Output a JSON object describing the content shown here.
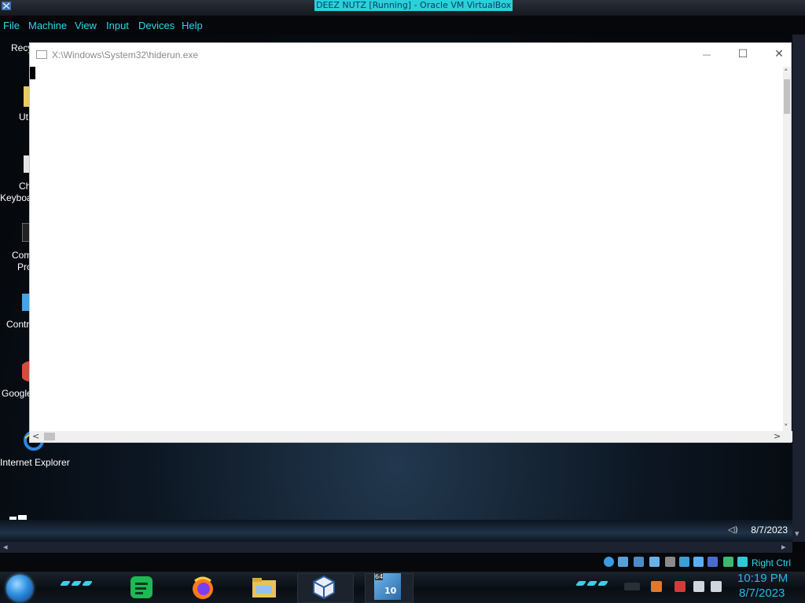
{
  "host": {
    "window_title": "DEEZ NUTZ [Running] - Oracle VM VirtualBox",
    "menu": [
      "File",
      "Machine",
      "View",
      "Input",
      "Devices",
      "Help"
    ],
    "status_hostkey": "Right Ctrl",
    "clock": {
      "time": "10:19 PM",
      "date": "8/7/2023"
    },
    "taskbar_badge": "10",
    "taskbar_badge_top": "64"
  },
  "guest": {
    "desktop_icons": [
      {
        "label": "Recy",
        "icon": "recycle-bin-icon"
      },
      {
        "label": "Ut",
        "icon": "folder-icon"
      },
      {
        "label": "Ch",
        "label2": "Keyboa",
        "icon": "keyboard-icon"
      },
      {
        "label": "Com",
        "label2": "Pro",
        "icon": "command-prompt-icon"
      },
      {
        "label": "Contr",
        "icon": "control-panel-icon"
      },
      {
        "label": "Google",
        "icon": "chrome-icon"
      },
      {
        "label": "Internet Explorer",
        "icon": "internet-explorer-icon"
      }
    ],
    "console": {
      "title": "X:\\Windows\\System32\\hiderun.exe",
      "minimize": "—",
      "maximize": "☐",
      "close": "✕"
    },
    "taskbar_date": "8/7/2023",
    "sound_label": "◁)"
  },
  "colors": {
    "accent_cyan": "#2ed8e8",
    "clock_blue": "#29b8e4",
    "title_highlight": "#2ad1d8"
  }
}
